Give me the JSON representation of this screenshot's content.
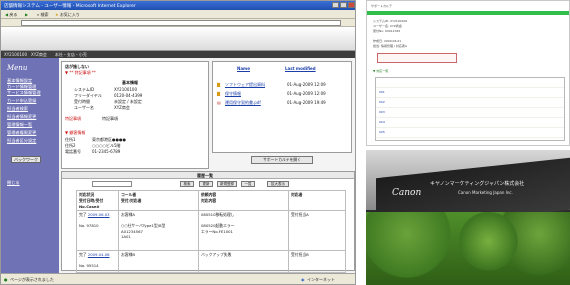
{
  "window": {
    "title": "店舗情報システム - ユーザー情報 - Microsoft Internet Explorer"
  },
  "toolbar": {
    "back": "戻る",
    "search": "検索",
    "favorites": "お気に入り"
  },
  "appbar": {
    "band_text": "XY2100100　XYZ商会　　本社・支店・小売"
  },
  "sidebar": {
    "title": "Menu",
    "links": [
      "基本情報設定",
      "カード情報管理",
      "サービス情報管理",
      "カード申込登録",
      "担当者検索",
      "担当者情報変更",
      "管理情報一覧",
      "管理者権限変更",
      "担当者区分設定"
    ],
    "back_button": "バックワーク",
    "footer_link": "閉じる"
  },
  "info_panel": {
    "header": "店が施しない",
    "subheader": "▼ ** 特記事項 **",
    "basic_title": "基本情報",
    "rows": [
      {
        "label": "システムID",
        "value": "XY2100100"
      },
      {
        "label": "フリーダイヤル",
        "value": "0120-04-4399"
      },
      {
        "label": "受付時間",
        "value": "未設定 / 未設定"
      },
      {
        "label": "ユーザー名",
        "value": "XYZ商会"
      }
    ],
    "notice_label": "特記事項",
    "notice_value": "特記事項",
    "section2": "▼ 顧客情報",
    "rows2": [
      {
        "label": "住所1",
        "value": "東京都港区●●●●"
      },
      {
        "label": "住所2",
        "value": "○○○○ビル5階"
      },
      {
        "label": "電話番号",
        "value": "01-2345-6789"
      }
    ]
  },
  "files_panel": {
    "col_name": "Name",
    "col_modified": "Last modified",
    "files": [
      {
        "name": "ソフトウェア提出資料",
        "date": "01-Aug-2009 12:09"
      },
      {
        "name": "保守情報",
        "date": "01-Aug-2009 12:09"
      },
      {
        "name": "運用保守契約書.pdf",
        "date": "01-Aug-2009 19:49"
      }
    ],
    "support_button": "サポートカルテを開く"
  },
  "history": {
    "title": "履歴一覧",
    "search_button": "検索",
    "refresh_button": "更新",
    "register_button": "新規登録",
    "export_button": "一覧",
    "display_button": "拡大表示",
    "head1": "対応状況",
    "head1b": "受付日時/受付No.Case#",
    "head2": "コール者",
    "head2b": "受付/対応者",
    "head3": "依頼内容",
    "head3b": "対応内容",
    "head4": "対応者",
    "rows": [
      {
        "status": "完了",
        "date": "2009.06.03",
        "no": "No. 97810",
        "caller": "お客様A",
        "detail": "○○社サーバType1型/B型",
        "code": "A01234567",
        "code2": "1A01",
        "c1": "080510移転処理し",
        "c2": "080520起動エラー",
        "c3": "エラーNo.FE1001",
        "owner": "受付担当A"
      },
      {
        "status": "完了",
        "date": "2009.04.06",
        "no": "No. 95514",
        "caller": "お客様B",
        "detail": "",
        "code": "",
        "code2": "",
        "c1": "バックアップ失敗",
        "c2": "",
        "c3": "",
        "owner": "受付担当B"
      }
    ]
  },
  "status": {
    "left": "ページが表示されました",
    "right": "インターネット"
  },
  "right_screenshot": {
    "title": "サポートカルテ",
    "lines": [
      "システムID: XY2100100",
      "ユーザー名: XYZ商会",
      "受付No: 00012345",
      "作成日: 2009.06.01",
      "担当: 情報管理 / 対応者A"
    ],
    "section": "▼ 対応一覧",
    "table_rows": [
      "001",
      "002",
      "003",
      "004",
      "005",
      "006"
    ]
  },
  "photo": {
    "sign_logo": "Canon",
    "sign_jp": "キヤノンマーケティングジャパン株式会社",
    "sign_en": "Canon Marketing Japan Inc."
  },
  "colors": {
    "sidebar": "#6f73b5",
    "titlebar": "#2a5bc4",
    "accent_red": "#cc1111",
    "green_bar": "#2fbf4a"
  }
}
